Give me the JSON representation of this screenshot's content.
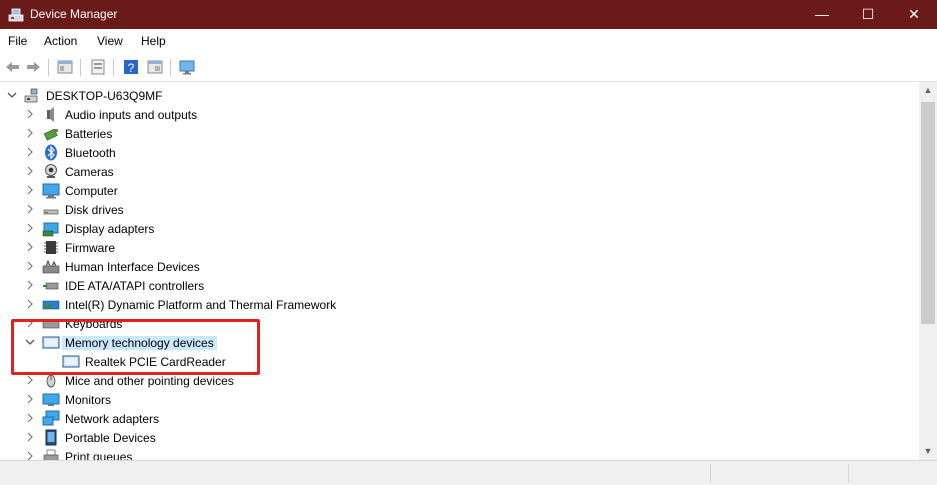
{
  "window": {
    "title": "Device Manager",
    "icon": "device-manager-icon",
    "controls": {
      "minimize": "—",
      "maximize": "☐",
      "close": "✕"
    }
  },
  "menu": [
    "File",
    "Action",
    "View",
    "Help"
  ],
  "toolbar": [
    "back-arrow-icon",
    "forward-arrow-icon",
    "properties-icon",
    "update-driver-icon",
    "help-icon",
    "show-hidden-icon",
    "monitor-icon"
  ],
  "tree": {
    "root": "DESKTOP-U63Q9MF",
    "items": [
      {
        "label": "Audio inputs and outputs",
        "icon": "speaker-icon"
      },
      {
        "label": "Batteries",
        "icon": "battery-icon"
      },
      {
        "label": "Bluetooth",
        "icon": "bluetooth-icon"
      },
      {
        "label": "Cameras",
        "icon": "camera-icon"
      },
      {
        "label": "Computer",
        "icon": "computer-icon"
      },
      {
        "label": "Disk drives",
        "icon": "disk-drive-icon"
      },
      {
        "label": "Display adapters",
        "icon": "display-adapter-icon"
      },
      {
        "label": "Firmware",
        "icon": "firmware-icon"
      },
      {
        "label": "Human Interface Devices",
        "icon": "hid-icon"
      },
      {
        "label": "IDE ATA/ATAPI controllers",
        "icon": "ide-icon"
      },
      {
        "label": "Intel(R) Dynamic Platform and Thermal Framework",
        "icon": "chip-icon"
      },
      {
        "label": "Keyboards",
        "icon": "keyboard-icon"
      },
      {
        "label": "Memory technology devices",
        "icon": "memory-device-icon",
        "expanded": true,
        "selected": true,
        "children": [
          {
            "label": "Realtek PCIE CardReader",
            "icon": "memory-device-icon"
          }
        ]
      },
      {
        "label": "Mice and other pointing devices",
        "icon": "mouse-icon"
      },
      {
        "label": "Monitors",
        "icon": "monitor-icon"
      },
      {
        "label": "Network adapters",
        "icon": "network-adapter-icon"
      },
      {
        "label": "Portable Devices",
        "icon": "portable-device-icon"
      },
      {
        "label": "Print queues",
        "icon": "printer-icon"
      }
    ]
  },
  "colors": {
    "titlebar": "#6b1a1a",
    "selection": "#cce8ff",
    "highlight": "#e42020"
  }
}
